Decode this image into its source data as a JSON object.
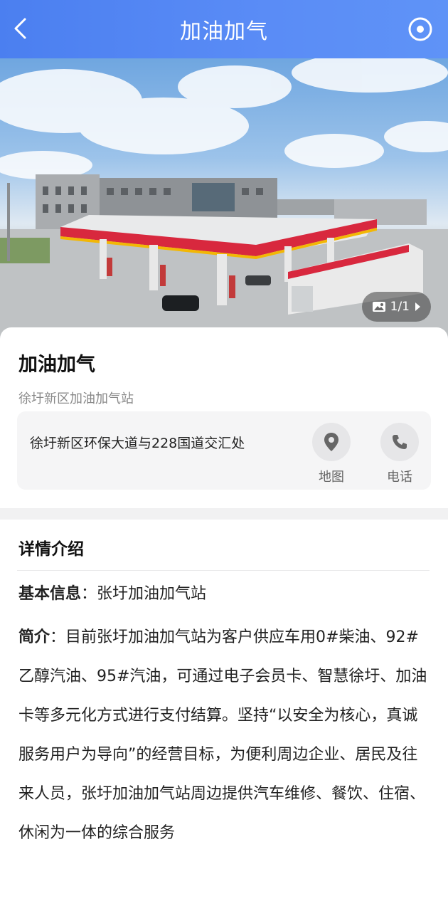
{
  "header": {
    "title": "加油加气",
    "back_icon": "chevron-left-icon",
    "right_icon": "target-circle-icon"
  },
  "hero": {
    "counter": "1/1",
    "counter_icon": "image-icon",
    "next_icon": "caret-right-icon"
  },
  "station": {
    "name": "加油加气",
    "subtitle": "徐圩新区加油加气站",
    "address": "徐圩新区环保大道与228国道交汇处",
    "actions": [
      {
        "label": "地图",
        "icon": "map-pin-icon"
      },
      {
        "label": "电话",
        "icon": "phone-icon"
      }
    ]
  },
  "details": {
    "title": "详情介绍",
    "basic_label": "基本信息",
    "basic_value": "张圩加油加气站",
    "intro_label": "简介",
    "intro_text": "目前张圩加油加气站为客户供应车用0#柴油、92#乙醇汽油、95#汽油，可通过电子会员卡、智慧徐圩、加油卡等多元化方式进行支付结算。坚持“以安全为核心，真诚服务用户为导向”的经营目标，为便利周边企业、居民及往来人员，张圩加油加气站周边提供汽车维修、餐饮、住宿、休闲为一体的综合服务"
  },
  "colors": {
    "header": "#5a8cf6",
    "canopy_red": "#d8283e",
    "canopy_yellow": "#f2b705"
  }
}
